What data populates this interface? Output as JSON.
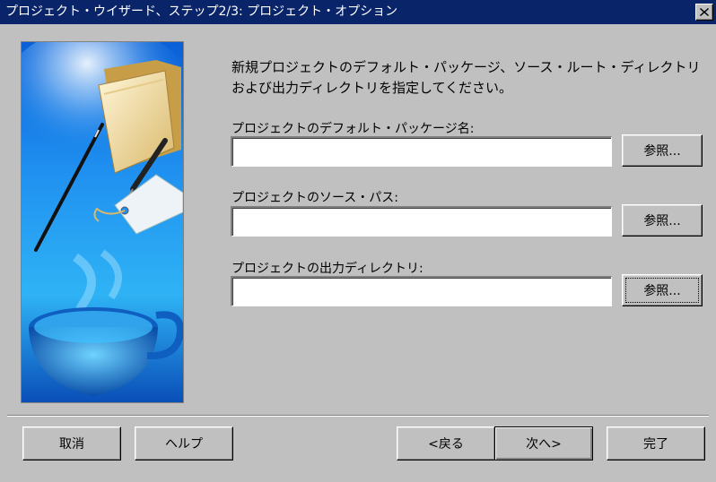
{
  "window": {
    "title": "プロジェクト・ウイザード、ステップ2/3: プロジェクト・オプション",
    "close_glyph": "✕"
  },
  "description": "新規プロジェクトのデフォルト・パッケージ、ソース・ルート・ディレクトリおよび出力ディレクトリを指定してください。",
  "fields": [
    {
      "label": "プロジェクトのデフォルト・パッケージ名:",
      "value": "",
      "browse_label": "参照..."
    },
    {
      "label": "プロジェクトのソース・パス:",
      "value": "",
      "browse_label": "参照..."
    },
    {
      "label": "プロジェクトの出力ディレクトリ:",
      "value": "",
      "browse_label": "参照..."
    }
  ],
  "buttons": {
    "cancel": "取消",
    "help": "ヘルプ",
    "back": "<戻る",
    "next": "次へ>",
    "finish": "完了"
  },
  "colors": {
    "titlebar": "#0a246a",
    "dialog_bg": "#c0c0c0",
    "image_blue": "#1e8fe8"
  },
  "icons": {
    "side_image": "wizard-illustration-folder-pen-tag-cup"
  }
}
